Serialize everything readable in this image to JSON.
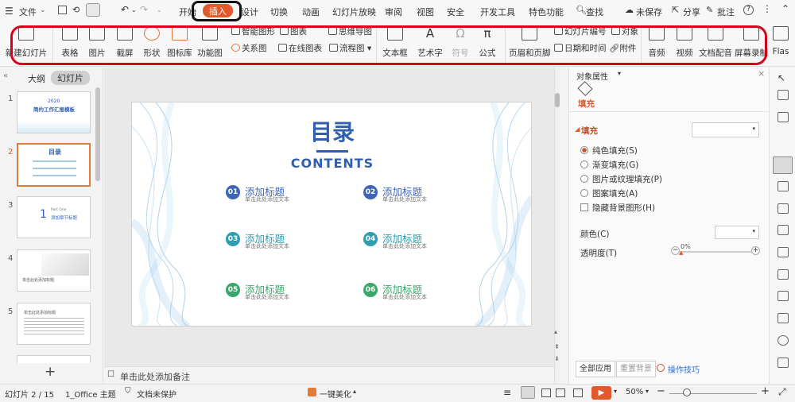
{
  "menubar": {
    "file": "文件",
    "tabs": [
      "开始",
      "插入",
      "设计",
      "切换",
      "动画",
      "幻灯片放映",
      "审阅",
      "视图",
      "安全",
      "开发工具",
      "特色功能"
    ],
    "search": "查找",
    "save_status": "未保存",
    "share": "分享",
    "comment": "批注"
  },
  "ribbon": {
    "new_slide": "新建幻灯片",
    "table": "表格",
    "picture": "图片",
    "screenshot": "截屏",
    "shapes": "形状",
    "icon_library": "图标库",
    "function_chart": "功能图",
    "smart_graphic": "智能图形",
    "chart": "图表",
    "mind_map": "思维导图",
    "relation_chart": "关系图",
    "online_chart": "在线图表",
    "flowchart": "流程图",
    "textbox": "文本框",
    "wordart": "艺术字",
    "symbol": "符号",
    "formula": "公式",
    "header_footer": "页眉和页脚",
    "slide_number": "幻灯片编号",
    "object": "对象",
    "date_time": "日期和时间",
    "attachment": "附件",
    "audio": "音频",
    "video": "视频",
    "doc_dub": "文档配音",
    "screen_record": "屏幕录制",
    "flash": "Flas"
  },
  "left_panel": {
    "tab_outline": "大纲",
    "tab_slides": "幻灯片",
    "slide_numbers": [
      "1",
      "2",
      "3",
      "4",
      "5"
    ],
    "thumb1": {
      "year": "2020",
      "title": "简约工作汇报模板"
    },
    "thumb2": {
      "title": "目录"
    },
    "thumb3": {
      "num": "1",
      "part": "Part One",
      "title": "添加章节标题"
    },
    "thumb4": {
      "title": "单击此处添加标题"
    },
    "thumb5": {
      "title": "单击此处添加标题"
    }
  },
  "slide": {
    "title_cn": "目录",
    "title_en": "CONTENTS",
    "items": [
      {
        "num": "01",
        "title": "添加标题",
        "sub": "单击此处添加文本",
        "color": "#3d67b6"
      },
      {
        "num": "02",
        "title": "添加标题",
        "sub": "单击此处添加文本",
        "color": "#3d67b6"
      },
      {
        "num": "03",
        "title": "添加标题",
        "sub": "单击此处添加文本",
        "color": "#2d9fb0"
      },
      {
        "num": "04",
        "title": "添加标题",
        "sub": "单击此处添加文本",
        "color": "#2d9fb0"
      },
      {
        "num": "05",
        "title": "添加标题",
        "sub": "单击此处添加文本",
        "color": "#3aa86a"
      },
      {
        "num": "06",
        "title": "添加标题",
        "sub": "单击此处添加文本",
        "color": "#3aa86a"
      }
    ]
  },
  "notes_placeholder": "单击此处添加备注",
  "right_panel": {
    "title": "对象属性",
    "tab_fill": "填充",
    "section_fill": "填充",
    "options": [
      "纯色填充(S)",
      "渐变填充(G)",
      "图片或纹理填充(P)",
      "图案填充(A)"
    ],
    "hide_bg": "隐藏背景图形(H)",
    "color_label": "颜色(C)",
    "transparency_label": "透明度(T)",
    "transparency_value": "0%",
    "apply_all": "全部应用",
    "reset_bg": "重置背景",
    "tips": "操作技巧"
  },
  "status": {
    "slide_pos": "幻灯片 2 / 15",
    "theme": "1_Office 主题",
    "protect": "文档未保护",
    "beautify": "一键美化",
    "zoom": "50%"
  },
  "colors": {
    "accent": "#e05a2b",
    "title_blue": "#2f5fae",
    "mark_red": "#d9001b"
  }
}
